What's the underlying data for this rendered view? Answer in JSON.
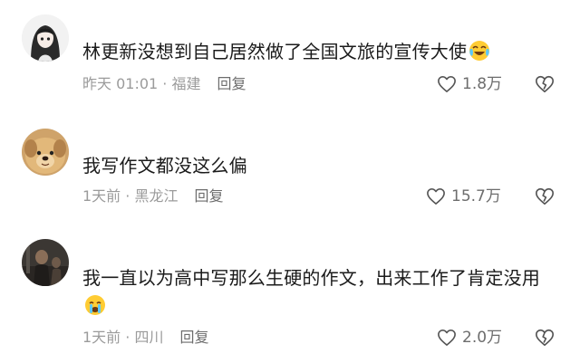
{
  "comments": [
    {
      "avatar": "anime-girl-avatar",
      "text": "林更新没想到自己居然做了全国文旅的宣传大使",
      "emoji": "laugh-cry-emoji",
      "time_location": "昨天 01:01 · 福建",
      "reply_label": "回复",
      "likes": "1.8万"
    },
    {
      "avatar": "puppy-avatar",
      "text": "我写作文都没这么偏",
      "emoji": "",
      "time_location": "1天前 · 黑龙江",
      "reply_label": "回复",
      "likes": "15.7万"
    },
    {
      "avatar": "dark-portrait-avatar",
      "text": "我一直以为高中写那么生硬的作文，出来工作了肯定没用",
      "emoji": "crying-emoji",
      "time_location": "1天前 · 四川",
      "reply_label": "回复",
      "likes": "2.0万"
    }
  ],
  "icons": {
    "like": "heart-outline-icon",
    "dislike": "broken-heart-icon"
  }
}
